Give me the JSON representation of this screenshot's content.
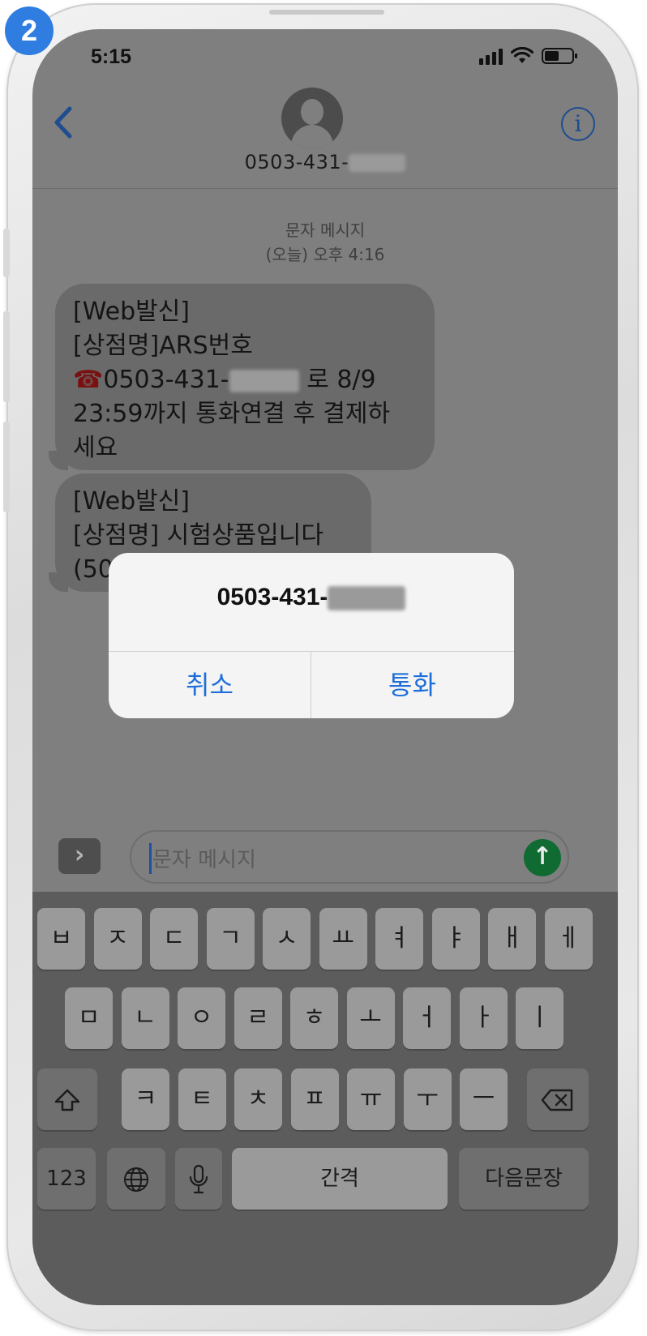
{
  "step_badge": "2",
  "status_bar": {
    "time": "5:15"
  },
  "header": {
    "contact_prefix": "0503-431-",
    "back_icon": "chevron-left-icon",
    "info_icon": "info-icon"
  },
  "conversation": {
    "service": "문자 메시지",
    "timestamp": "(오늘) 오후 4:16",
    "messages": [
      {
        "lines": [
          "[Web발신]",
          "[상점명]ARS번호",
          "0503-431-",
          "로 8/9",
          "23:59까지 통화연결 후 결제하",
          "세요"
        ]
      },
      {
        "lines": [
          "[Web발신]",
          "[상점명] 시험상품입니다",
          "(50"
        ]
      }
    ]
  },
  "alert": {
    "title_prefix": "0503-431-",
    "cancel": "취소",
    "call": "통화"
  },
  "composer": {
    "placeholder": "문자 메시지"
  },
  "keyboard": {
    "row1": [
      "ㅂ",
      "ㅈ",
      "ㄷ",
      "ㄱ",
      "ㅅ",
      "ㅛ",
      "ㅕ",
      "ㅑ",
      "ㅐ",
      "ㅔ"
    ],
    "row2": [
      "ㅁ",
      "ㄴ",
      "ㅇ",
      "ㄹ",
      "ㅎ",
      "ㅗ",
      "ㅓ",
      "ㅏ",
      "ㅣ"
    ],
    "row3": [
      "ㅋ",
      "ㅌ",
      "ㅊ",
      "ㅍ",
      "ㅠ",
      "ㅜ",
      "ㅡ"
    ],
    "numbers": "123",
    "space": "간격",
    "next": "다음문장"
  },
  "colors": {
    "screen_dim": "#7f7f7f",
    "accent": "#1e6fd9",
    "send": "#0f6b32",
    "badge": "#2f7de1"
  }
}
